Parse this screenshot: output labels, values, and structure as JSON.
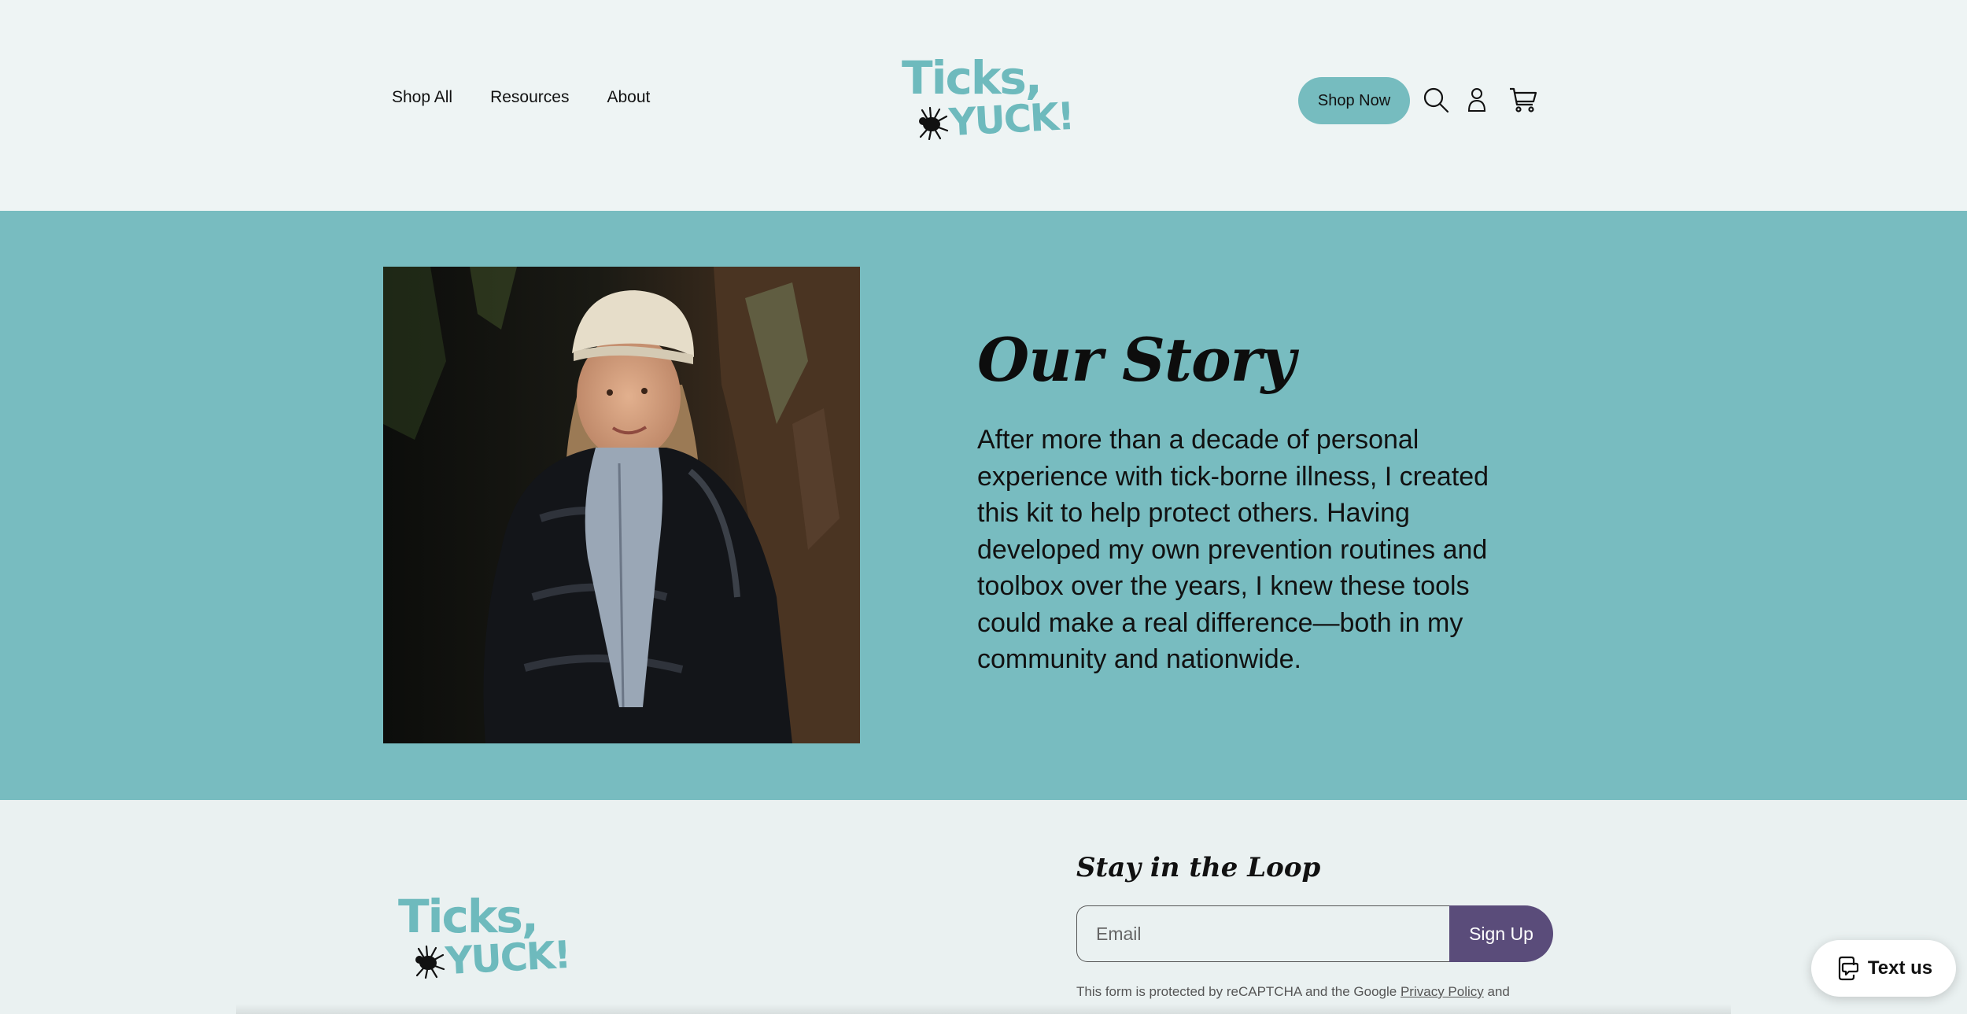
{
  "header": {
    "nav": [
      {
        "label": "Shop All"
      },
      {
        "label": "Resources"
      },
      {
        "label": "About"
      }
    ],
    "logo": {
      "line1": "Ticks,",
      "line2": "YUCK!"
    },
    "shop_now_label": "Shop Now",
    "icons": [
      "search-icon",
      "account-icon",
      "cart-icon"
    ]
  },
  "story": {
    "title": "Our Story",
    "body": "After more than a decade of personal experience with tick-borne illness, I created this kit to help protect others. Having developed my own prevention routines and toolbox over the years, I knew these tools could make a real difference—both in my community and nationwide."
  },
  "footer": {
    "logo": {
      "line1": "Ticks,",
      "line2": "YUCK!"
    },
    "newsletter_title": "Stay in the Loop",
    "email_placeholder": "Email",
    "signup_label": "Sign Up",
    "recaptcha_prefix": "This form is protected by reCAPTCHA and the Google ",
    "privacy_link": "Privacy Policy",
    "recaptcha_suffix": " and"
  },
  "chat_widget": {
    "label": "Text us"
  },
  "colors": {
    "teal": "#78bcc0",
    "logo_teal": "#6ebabd",
    "purple": "#5a4c7a",
    "header_bg": "#eef4f4"
  }
}
